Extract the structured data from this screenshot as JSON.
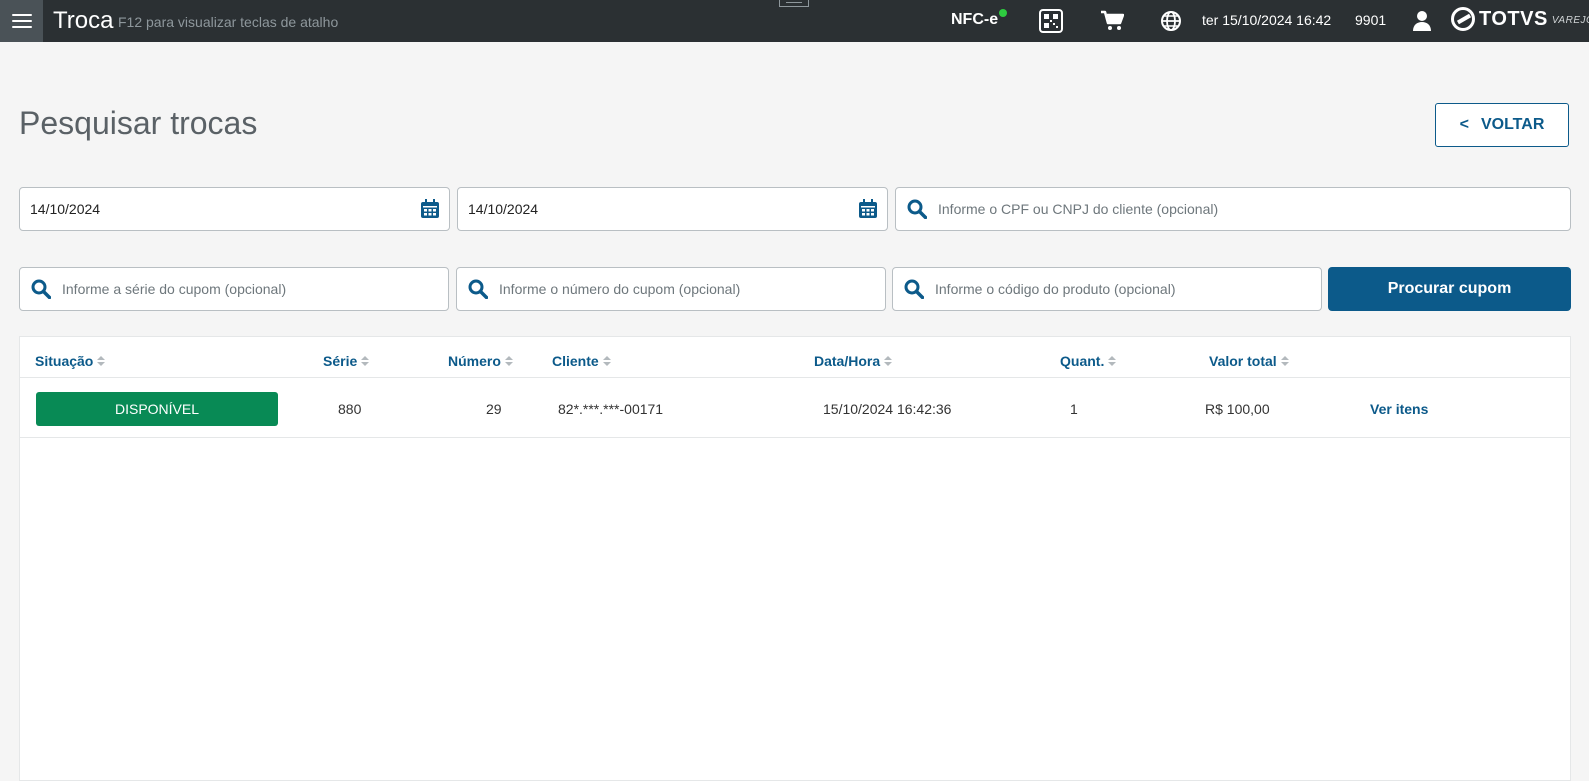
{
  "topbar": {
    "app_title": "Troca",
    "hint": "F12 para visualizar teclas de atalho",
    "nfce_label": "NFC-e",
    "datetime": "ter 15/10/2024 16:42",
    "terminal": "9901",
    "brand": "TOTVS",
    "brand_sub": "VAREJO",
    "status_color": "#2ecc40"
  },
  "page": {
    "title": "Pesquisar trocas",
    "back_button": "VOLTAR",
    "back_chevron": "<"
  },
  "filters": {
    "date_start": "14/10/2024",
    "date_end": "14/10/2024",
    "cpf_placeholder": "Informe o CPF ou CNPJ do cliente (opcional)",
    "serie_placeholder": "Informe a série do cupom (opcional)",
    "numero_placeholder": "Informe o número do cupom (opcional)",
    "produto_placeholder": "Informe o código do produto (opcional)",
    "search_button": "Procurar cupom"
  },
  "table": {
    "headers": [
      "Situação",
      "Série",
      "Número",
      "Cliente",
      "Data/Hora",
      "Quant.",
      "Valor total"
    ],
    "rows": [
      {
        "situacao": "DISPONÍVEL",
        "serie": "880",
        "numero": "29",
        "cliente": "82*.***.***-00171",
        "data_hora": "15/10/2024 16:42:36",
        "quantidade": "1",
        "valor_total": "R$ 100,00",
        "action": "Ver itens"
      }
    ]
  },
  "colors": {
    "primary": "#0c5a8a",
    "success": "#088a55",
    "topbar": "#2b3033"
  },
  "icons": [
    "menu-icon",
    "qrcode-icon",
    "cart-icon",
    "globe-icon",
    "user-icon",
    "calendar-icon",
    "search-icon",
    "sort-icon",
    "totvs-logo-icon"
  ]
}
